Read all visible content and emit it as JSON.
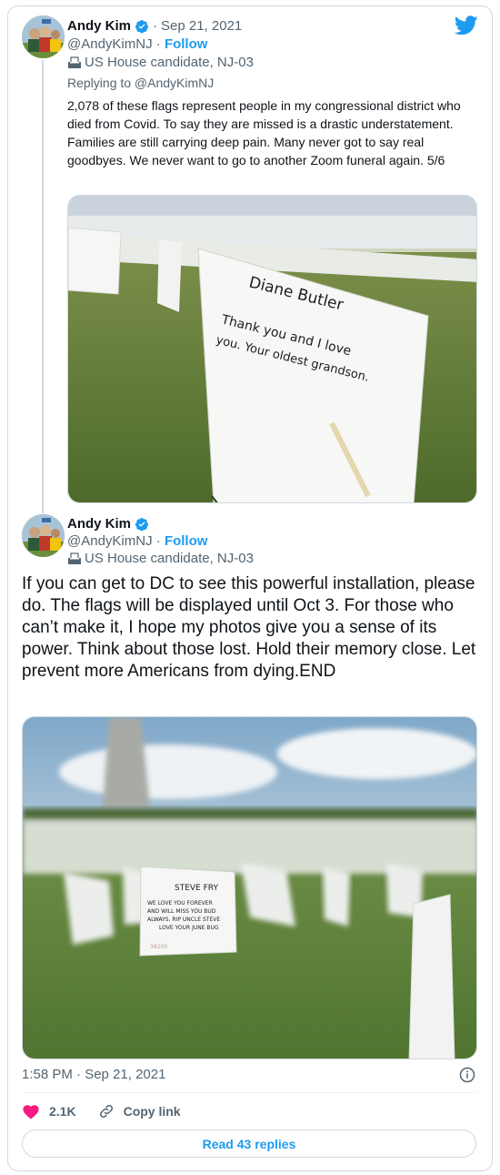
{
  "tweet1": {
    "display_name": "Andy Kim",
    "date": "Sep 21, 2021",
    "handle": "@AndyKimNJ",
    "follow_label": "Follow",
    "label": "US House candidate, NJ-03",
    "replying_to": "Replying to @AndyKimNJ",
    "text": "2,078 of these flags represent people in my congressional district who died from Covid. To say they are missed is a drastic understatement. Families are still carrying deep pain. Many never got to say real goodbyes. We never want to go to another Zoom funeral again. 5/6",
    "image": {
      "flag_line1": "Diane Butler",
      "flag_line2": "Thank you and I love",
      "flag_line3": "you. Your oldest grandson."
    }
  },
  "tweet2": {
    "display_name": "Andy Kim",
    "handle": "@AndyKimNJ",
    "follow_label": "Follow",
    "label": "US House candidate, NJ-03",
    "text": "If you can get to DC to see this powerful installation, please do.  The flags will be displayed until Oct 3. For those who can’t make it, I hope my photos give you a sense of its power. Think about those lost. Hold their memory close. Let prevent more Americans from dying.END",
    "image": {
      "flag_line1": "STEVE FRY",
      "flag_line2": "WE LOVE YOU FOREVER",
      "flag_line3": "AND WILL MISS YOU BUD",
      "flag_line4": "ALWAYS. RIP UNCLE STEVE",
      "flag_line5": "LOVE YOUR JUNE BUG",
      "flag_number": "38200"
    },
    "timestamp": "1:58 PM · Sep 21, 2021",
    "likes": "2.1K",
    "copy_link_label": "Copy link",
    "read_replies_label": "Read 43 replies"
  },
  "icons": {
    "brand": "twitter-bird-icon",
    "verified": "verified-badge-icon",
    "label": "ballot-box-icon",
    "info": "info-icon",
    "like": "heart-icon",
    "copy": "link-icon"
  },
  "colors": {
    "accent": "#1d9bf0",
    "like": "#f91880",
    "text": "#0f1419",
    "muted": "#536471",
    "border": "#cfd9de"
  }
}
